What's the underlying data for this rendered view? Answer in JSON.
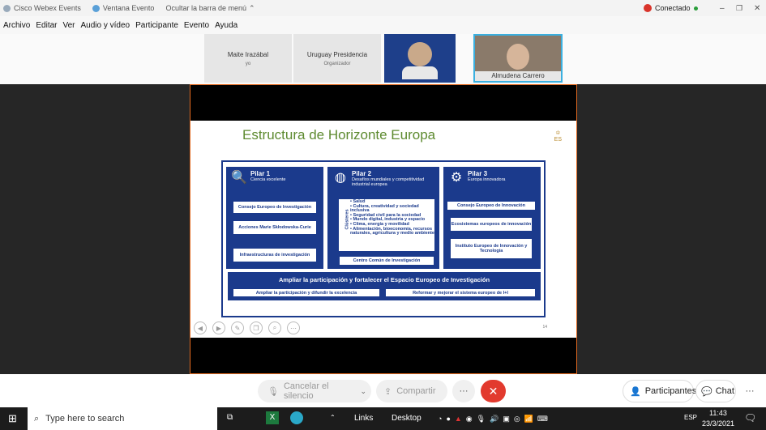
{
  "titlebar": {
    "app": "Cisco Webex Events",
    "window": "Ventana Evento",
    "hide_menu": "Ocultar la barra de menú",
    "status": "Conectado"
  },
  "menu": [
    "Archivo",
    "Editar",
    "Ver",
    "Audio y vídeo",
    "Participante",
    "Evento",
    "Ayuda"
  ],
  "participants": [
    {
      "name": "Maite Irazábal",
      "role": "yo"
    },
    {
      "name": "Uruguay Presidencia",
      "role": "Organizador"
    },
    {
      "name": "Almudena Carrero",
      "role": ""
    }
  ],
  "slide": {
    "title": "Estructura de Horizonte Europa",
    "page": "14",
    "pillar1": {
      "title": "Pilar 1",
      "subtitle": "Ciencia excelente",
      "items": [
        "Consejo Europeo de Investigación",
        "Acciones Marie Skłodowska-Curie",
        "Infraestructuras de investigación"
      ]
    },
    "pillar2": {
      "title": "Pilar 2",
      "subtitle": "Desafíos mundiales y competitividad industrial europea",
      "clusters_label": "Clústeres",
      "clusters": [
        "Salud",
        "Cultura, creatividad y sociedad inclusiva",
        "Seguridad civil para la sociedad",
        "Mundo digital, industria y espacio",
        "Clima, energía y movilidad",
        "Alimentación, bioeconomía, recursos naturales, agricultura y medio ambiente"
      ],
      "footer": "Centro Común de Investigación"
    },
    "pillar3": {
      "title": "Pilar 3",
      "subtitle": "Europa innovadora",
      "items": [
        "Consejo Europeo de Innovación",
        "Ecosistemas europeos de innovación",
        "Instituto Europeo de Innovación y Tecnología"
      ]
    },
    "band": {
      "title": "Ampliar la participación y fortalecer el Espacio Europeo de Investigación",
      "left": "Ampliar la participación y difundir la excelencia",
      "right": "Reformar y mejorar el sistema europeo de I+I"
    }
  },
  "controls": {
    "mute": "Cancelar el silencio",
    "share": "Compartir",
    "more": "···",
    "participants": "Participantes",
    "chat": "Chat"
  },
  "taskbar": {
    "search": "Type here to search",
    "links": "Links",
    "desktop": "Desktop",
    "lang": "ESP",
    "time": "11:43",
    "date": "23/3/2021"
  }
}
